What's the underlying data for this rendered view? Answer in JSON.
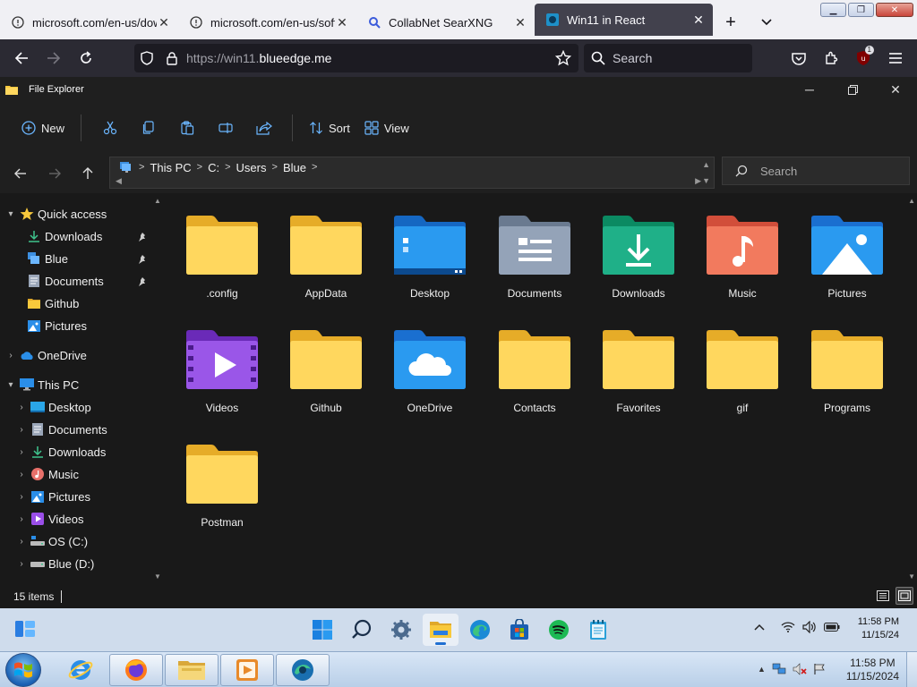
{
  "browser": {
    "tabs": [
      {
        "label": "microsoft.com/en-us/dow",
        "icon": "globe-icon",
        "active": false
      },
      {
        "label": "microsoft.com/en-us/soft",
        "icon": "globe-icon",
        "active": false
      },
      {
        "label": "CollabNet SearXNG",
        "icon": "search-icon",
        "active": false
      },
      {
        "label": "Win11 in React",
        "icon": "win11-favicon",
        "active": true
      }
    ],
    "url_prefix": "https://win11.",
    "url_domain": "blueedge.me",
    "search_placeholder": "Search",
    "extension_badge": "1"
  },
  "explorer": {
    "title": "File Explorer",
    "commands": {
      "new": "New",
      "sort": "Sort",
      "view": "View"
    },
    "breadcrumb": [
      "This PC",
      "C:",
      "Users",
      "Blue"
    ],
    "search_placeholder": "Search",
    "sidebar": [
      {
        "label": "Quick access",
        "icon": "star-icon",
        "level": 0,
        "expandable": true,
        "expanded": true
      },
      {
        "label": "Downloads",
        "icon": "download-icon",
        "level": 1,
        "pinned": true
      },
      {
        "label": "Blue",
        "icon": "user-folder-icon",
        "level": 1,
        "pinned": true
      },
      {
        "label": "Documents",
        "icon": "document-icon",
        "level": 1,
        "pinned": true
      },
      {
        "label": "Github",
        "icon": "folder-icon",
        "level": 1,
        "pinned": false
      },
      {
        "label": "Pictures",
        "icon": "pictures-icon",
        "level": 1,
        "pinned": false
      },
      {
        "label": "OneDrive",
        "icon": "cloud-icon",
        "level": 0,
        "expandable": true,
        "expanded": false
      },
      {
        "label": "This PC",
        "icon": "monitor-icon",
        "level": 0,
        "expandable": true,
        "expanded": true
      },
      {
        "label": "Desktop",
        "icon": "desktop-icon",
        "level": 1,
        "expandable": true
      },
      {
        "label": "Documents",
        "icon": "document-icon",
        "level": 1,
        "expandable": true
      },
      {
        "label": "Downloads",
        "icon": "download-icon",
        "level": 1,
        "expandable": true
      },
      {
        "label": "Music",
        "icon": "music-icon",
        "level": 1,
        "expandable": true
      },
      {
        "label": "Pictures",
        "icon": "pictures-icon",
        "level": 1,
        "expandable": true
      },
      {
        "label": "Videos",
        "icon": "videos-icon",
        "level": 1,
        "expandable": true
      },
      {
        "label": "OS (C:)",
        "icon": "drive-icon",
        "level": 1,
        "expandable": true
      },
      {
        "label": "Blue (D:)",
        "icon": "drive-icon",
        "level": 1,
        "expandable": true
      }
    ],
    "items": [
      {
        "name": ".config",
        "type": "folder"
      },
      {
        "name": "AppData",
        "type": "folder"
      },
      {
        "name": "Desktop",
        "type": "desktop"
      },
      {
        "name": "Documents",
        "type": "documents"
      },
      {
        "name": "Downloads",
        "type": "downloads"
      },
      {
        "name": "Music",
        "type": "music"
      },
      {
        "name": "Pictures",
        "type": "pictures"
      },
      {
        "name": "Videos",
        "type": "videos"
      },
      {
        "name": "Github",
        "type": "folder"
      },
      {
        "name": "OneDrive",
        "type": "onedrive"
      },
      {
        "name": "Contacts",
        "type": "folder"
      },
      {
        "name": "Favorites",
        "type": "folder"
      },
      {
        "name": "gif",
        "type": "folder"
      },
      {
        "name": "Programs",
        "type": "folder"
      },
      {
        "name": "Postman",
        "type": "folder"
      }
    ],
    "status": "15 items"
  },
  "win11_taskbar": {
    "time": "11:58 PM",
    "date": "11/15/24"
  },
  "win7_taskbar": {
    "time": "11:58 PM",
    "date": "11/15/2024"
  },
  "colors": {
    "folder_yellow": "#f8c93c",
    "accent_blue": "#1f6fd1"
  }
}
